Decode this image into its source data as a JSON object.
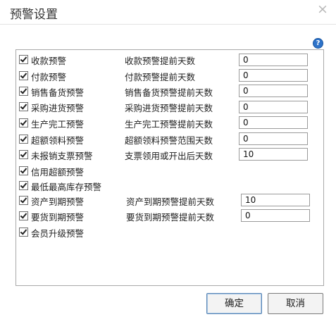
{
  "window": {
    "title": "预警设置",
    "close_glyph": "×",
    "help_glyph": "?"
  },
  "checks": [
    {
      "label": "收款预警",
      "checked": true
    },
    {
      "label": "付款预警",
      "checked": true
    },
    {
      "label": "销售备货预警",
      "checked": true
    },
    {
      "label": "采购进货预警",
      "checked": true
    },
    {
      "label": "生产完工预警",
      "checked": true
    },
    {
      "label": "超额领料预警",
      "checked": true
    },
    {
      "label": "未报销支票预警",
      "checked": true
    },
    {
      "label": "信用超额预警",
      "checked": true
    },
    {
      "label": "最低最高库存预警",
      "checked": true
    },
    {
      "label": "资产到期预警",
      "checked": true
    },
    {
      "label": "要货到期预警",
      "checked": true
    },
    {
      "label": "会员升级预警",
      "checked": true
    }
  ],
  "fields": [
    {
      "label": "收款预警提前天数",
      "value": "0"
    },
    {
      "label": "付款预警提前天数",
      "value": "0"
    },
    {
      "label": "销售备货预警提前天数",
      "value": "0"
    },
    {
      "label": "采购进货预警提前天数",
      "value": "0"
    },
    {
      "label": "生产完工预警提前天数",
      "value": "0"
    },
    {
      "label": "超额领料预警范围天数",
      "value": "0"
    },
    {
      "label": "支票领用或开出后天数",
      "value": "10"
    },
    {
      "label": "资产到期预警提前天数",
      "value": "10"
    },
    {
      "label": "要货到期预警提前天数",
      "value": "0"
    }
  ],
  "buttons": {
    "ok": "确定",
    "cancel": "取消"
  }
}
